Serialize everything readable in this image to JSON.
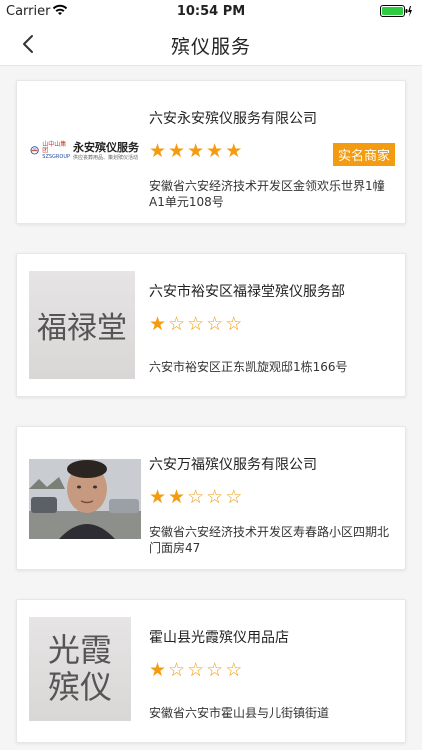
{
  "status": {
    "carrier": "Carrier",
    "time": "10:54 PM"
  },
  "nav": {
    "title": "殡仪服务"
  },
  "cards": [
    {
      "name": "六安永安殡仪服务有限公司",
      "rating": 5,
      "badge": "实名商家",
      "address": "安徽省六安经济技术开发区金领欢乐世界1幢A1单元108号",
      "thumb": {
        "type": "logo",
        "org": "山中山集团",
        "org_en": "SZSGROUP",
        "brand": "永安殡仪服务",
        "tagline": "供应丧葬用品、策划殡仪活动"
      }
    },
    {
      "name": "六安市裕安区福禄堂殡仪服务部",
      "rating": 1,
      "address": "六安市裕安区正东凯旋观邸1栋166号",
      "thumb": {
        "type": "text",
        "text": "福禄堂"
      }
    },
    {
      "name": "六安万福殡仪服务有限公司",
      "rating": 2,
      "address": "安徽省六安经济技术开发区寿春路小区四期北门面房47",
      "thumb": {
        "type": "photo"
      }
    },
    {
      "name": "霍山县光霞殡仪用品店",
      "rating": 1,
      "address": "安徽省六安市霍山县与儿街镇街道",
      "thumb": {
        "type": "text",
        "text": "光霞殡仪",
        "line1": "光霞",
        "line2": "殡仪"
      }
    }
  ],
  "colors": {
    "accent": "#f39c12"
  },
  "icons": {
    "back": "chevron-left-icon",
    "wifi": "wifi-icon",
    "battery": "battery-icon",
    "star": "star-icon"
  }
}
